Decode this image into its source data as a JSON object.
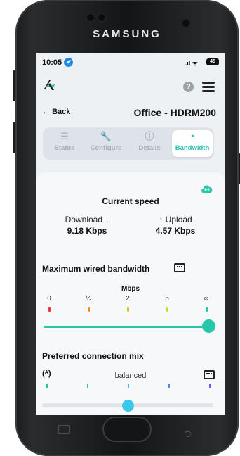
{
  "device": {
    "brand": "SAMSUNG"
  },
  "status_bar": {
    "time": "10:05",
    "signal": ".ıl ᯤ",
    "battery": "45"
  },
  "header": {
    "help": "?",
    "back_label": "Back",
    "back_arrow": "←",
    "title": "Office - HDRM200"
  },
  "tabs": [
    {
      "label": "Status",
      "icon": "status-list-icon",
      "glyph": "☰"
    },
    {
      "label": "Configure",
      "icon": "wrench-icon",
      "glyph": "🔧"
    },
    {
      "label": "Details",
      "icon": "info-icon",
      "glyph": "ⓘ"
    },
    {
      "label": "Bandwidth",
      "icon": "speedometer-icon",
      "glyph": "◔",
      "active": true
    }
  ],
  "current_speed": {
    "title": "Current speed",
    "download_label": "Download",
    "download_value": "9.18 Kbps",
    "upload_label": "Upload",
    "upload_value": "4.57 Kbps",
    "arrow_down": "↓",
    "arrow_up": "↑"
  },
  "max_bandwidth": {
    "title": "Maximum wired bandwidth",
    "unit": "Mbps",
    "ticks": [
      "0",
      "½",
      "2",
      "5",
      "∞"
    ],
    "tick_colors": [
      "#e53935",
      "#f08a24",
      "#e0c22a",
      "#c8da3a",
      "#27c6a9"
    ],
    "selected_tick_index": 4
  },
  "connection_mix": {
    "title": "Preferred connection mix",
    "value": "balanced",
    "left_icon": "(ᴬ)",
    "position_fraction": 0.5,
    "tick_colors": [
      "#27c6a9",
      "#27c6a9",
      "#3bc7ea",
      "#4a90e2",
      "#7a55f0"
    ]
  },
  "colors": {
    "accent": "#27c6a9",
    "download": "#7a55f0",
    "upload": "#1fc8d6"
  }
}
